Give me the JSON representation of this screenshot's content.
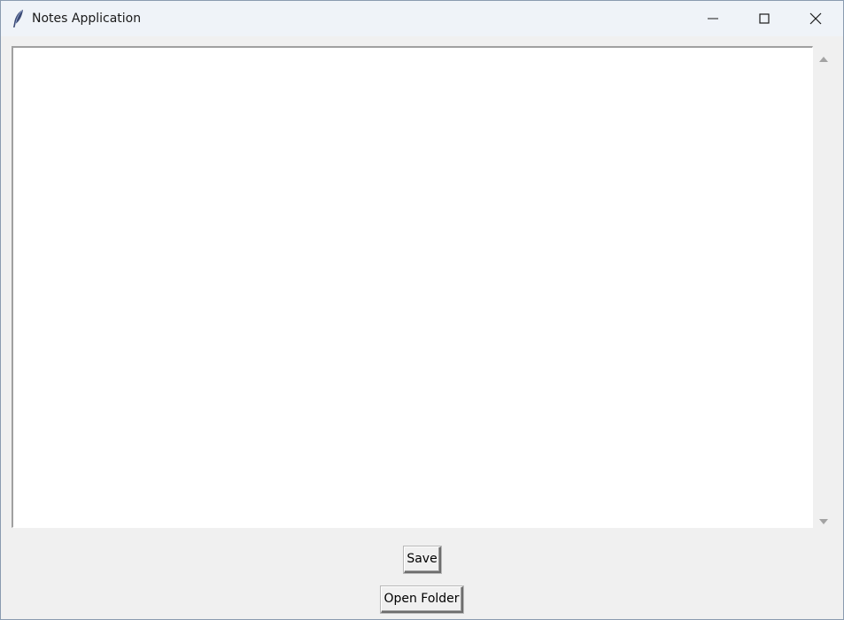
{
  "window": {
    "title": "Notes Application",
    "controls": {
      "minimize_icon": "minimize-icon",
      "maximize_icon": "maximize-icon",
      "close_icon": "close-icon"
    }
  },
  "editor": {
    "content": ""
  },
  "buttons": {
    "save_label": "Save",
    "open_folder_label": "Open Folder"
  },
  "colors": {
    "titlebar": "#eff3f8",
    "window_bg": "#f0f0f0",
    "editor_bg": "#ffffff"
  }
}
